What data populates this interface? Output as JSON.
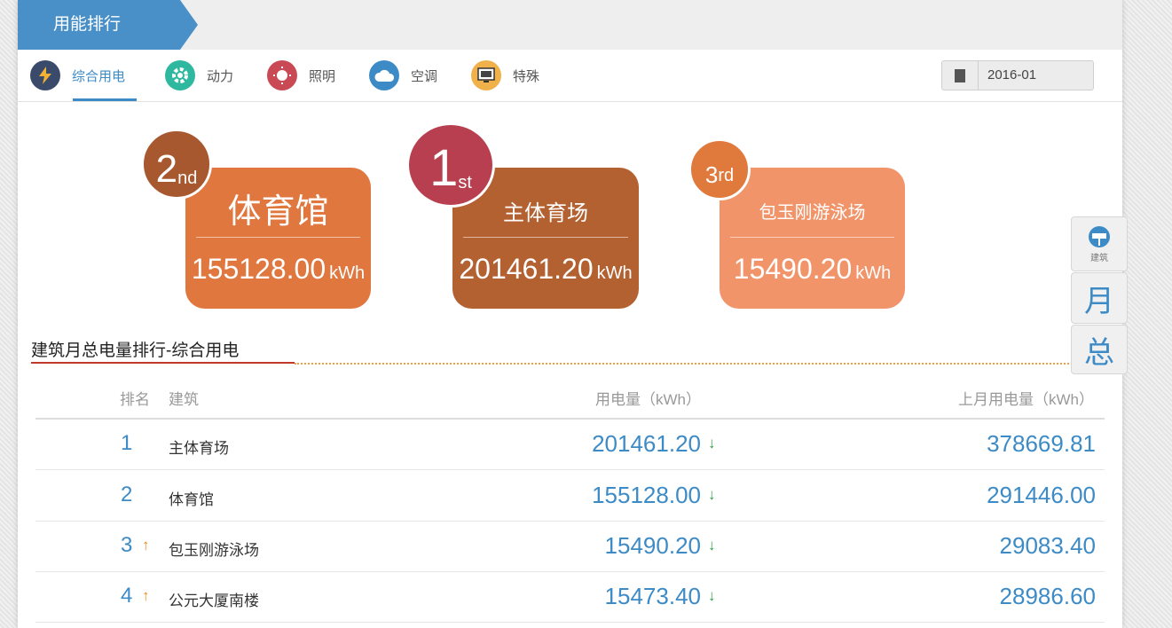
{
  "header": {
    "title": "用能排行"
  },
  "tabs": [
    {
      "label": "综合用电",
      "icon": "lightning-icon",
      "color": "#3a4a6b",
      "active": true
    },
    {
      "label": "动力",
      "icon": "gear-icon",
      "color": "#2fb8a0"
    },
    {
      "label": "照明",
      "icon": "lightbulb-icon",
      "color": "#c94a55"
    },
    {
      "label": "空调",
      "icon": "cloud-icon",
      "color": "#3d8bc6"
    },
    {
      "label": "特殊",
      "icon": "monitor-icon",
      "color": "#f0b14a"
    }
  ],
  "date": {
    "value": "2016-01"
  },
  "podium": [
    {
      "rank_num": "2",
      "rank_suffix": "nd",
      "name": "体育馆",
      "value": "155128.00",
      "unit": "kWh"
    },
    {
      "rank_num": "1",
      "rank_suffix": "st",
      "name": "主体育场",
      "value": "201461.20",
      "unit": "kWh"
    },
    {
      "rank_num": "3",
      "rank_suffix": "rd",
      "name": "包玉刚游泳场",
      "value": "15490.20",
      "unit": "kWh"
    }
  ],
  "section": {
    "title": "建筑月总电量排行-综合用电"
  },
  "table": {
    "headers": {
      "rank": "排名",
      "building": "建筑",
      "current": "用电量（kWh）",
      "previous": "上月用电量（kWh）"
    },
    "rows": [
      {
        "rank": "1",
        "name": "主体育场",
        "current": "201461.20",
        "previous": "378669.81",
        "rank_up": "",
        "trend": "↓"
      },
      {
        "rank": "2",
        "name": "体育馆",
        "current": "155128.00",
        "previous": "291446.00",
        "rank_up": "",
        "trend": "↓"
      },
      {
        "rank": "3",
        "name": "包玉刚游泳场",
        "current": "15490.20",
        "previous": "29083.40",
        "rank_up": "↑",
        "trend": "↓"
      },
      {
        "rank": "4",
        "name": "公元大厦南楼",
        "current": "15473.40",
        "previous": "28986.60",
        "rank_up": "↑",
        "trend": "↓"
      }
    ]
  },
  "side_nav": {
    "building_label": "建筑",
    "month_label": "月",
    "total_label": "总"
  }
}
